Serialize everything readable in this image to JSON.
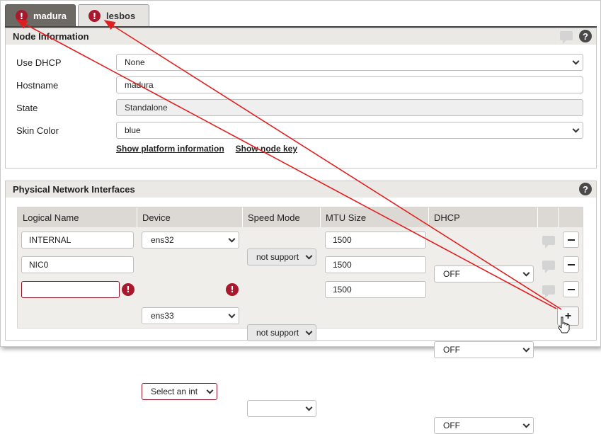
{
  "tabs": [
    {
      "label": "madura",
      "active": true,
      "status_icon": "error-icon"
    },
    {
      "label": "lesbos",
      "active": false,
      "status_icon": "error-icon"
    }
  ],
  "node_info": {
    "title": "Node Information",
    "help_icon": "?",
    "fields": {
      "use_dhcp": {
        "label": "Use DHCP",
        "value": "None"
      },
      "hostname": {
        "label": "Hostname",
        "value": "madura"
      },
      "state": {
        "label": "State",
        "value": "Standalone"
      },
      "skin_color": {
        "label": "Skin Color",
        "value": "blue"
      }
    },
    "links": {
      "platform": "Show platform information",
      "node_key": "Show node key"
    }
  },
  "interfaces": {
    "title": "Physical Network Interfaces",
    "help_icon": "?",
    "columns": [
      "Logical Name",
      "Device",
      "Speed Mode",
      "MTU Size",
      "DHCP"
    ],
    "rows": [
      {
        "logical_name": "INTERNAL",
        "device": "ens32",
        "speed_mode": "not support",
        "mtu": "1500",
        "dhcp": "OFF"
      },
      {
        "logical_name": "NIC0",
        "device": "ens33",
        "speed_mode": "not support",
        "mtu": "1500",
        "dhcp": "OFF"
      },
      {
        "logical_name": "",
        "device": "Select an int",
        "speed_mode": "",
        "mtu": "1500",
        "dhcp": "OFF"
      }
    ],
    "error_mark": "!",
    "add_button": "+"
  },
  "colors": {
    "error": "#a8192e",
    "annotation_arrow": "#e02020",
    "active_tab": "#6d6a66"
  }
}
